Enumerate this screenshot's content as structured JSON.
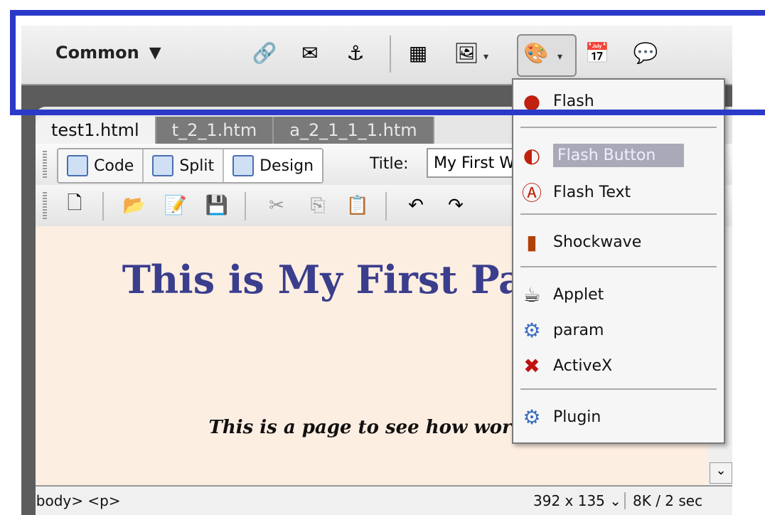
{
  "insert_bar": {
    "category": "Common",
    "icons": [
      "hyperlink-icon",
      "email-link-icon",
      "named-anchor-icon",
      "table-icon",
      "image-icon",
      "media-icon",
      "date-icon",
      "comment-icon"
    ]
  },
  "document": {
    "tabs": [
      "test1.html",
      "t_2_1.htm",
      "a_2_1_1_1.htm"
    ],
    "views": [
      "Code",
      "Split",
      "Design"
    ],
    "title_label": "Title:",
    "title_value": "My First W",
    "heading": "This is My First Page",
    "subtext": "This is a page to see how works"
  },
  "status_bar": {
    "tags": "<body> <p>",
    "dimensions": "392 x 135 ⌄",
    "size": "8K / 2 sec"
  },
  "media_menu": {
    "items": [
      "Flash",
      "Flash Button",
      "Flash Text",
      "Shockwave",
      "Applet",
      "param",
      "ActiveX",
      "Plugin"
    ],
    "highlighted": "Flash Button"
  },
  "colors": {
    "highlight_frame": "#2b39c9",
    "heading": "#3a3e8c",
    "canvas_bg": "#fdeee2"
  }
}
